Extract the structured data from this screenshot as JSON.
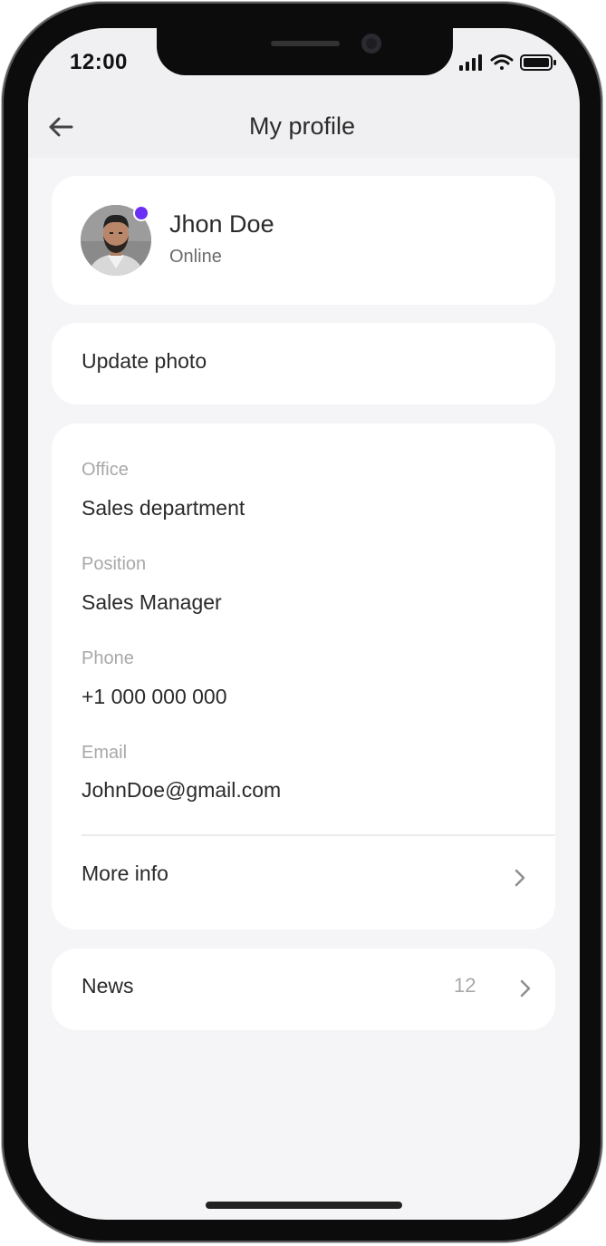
{
  "status_bar": {
    "time": "12:00"
  },
  "header": {
    "title": "My profile",
    "back_icon": "arrow-left-icon"
  },
  "profile": {
    "name": "Jhon Doe",
    "status": "Online",
    "presence_color": "#6a2ef5"
  },
  "actions": {
    "update_photo_label": "Update photo"
  },
  "details": {
    "fields": [
      {
        "label": "Office",
        "value": "Sales department"
      },
      {
        "label": "Position",
        "value": "Sales Manager"
      },
      {
        "label": "Phone",
        "value": "+1 000 000 000"
      },
      {
        "label": "Email",
        "value": "JohnDoe@gmail.com"
      }
    ],
    "more_info_label": "More info"
  },
  "news": {
    "label": "News",
    "count": "12"
  },
  "colors": {
    "accent": "#6a2ef5",
    "background": "#f5f5f7",
    "card": "#ffffff",
    "text_primary": "#2a2a2a",
    "text_secondary": "#a8a8a8"
  }
}
